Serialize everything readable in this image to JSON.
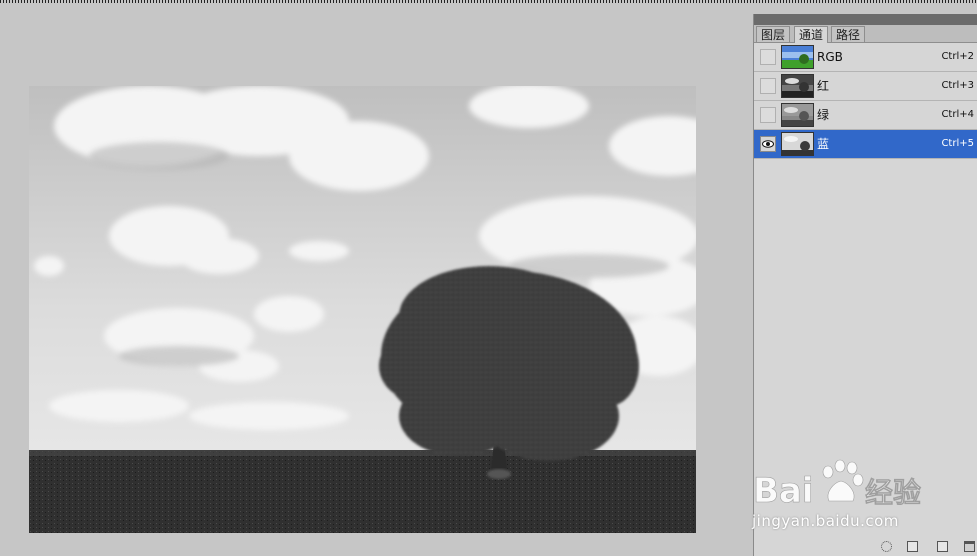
{
  "panel": {
    "tabs": [
      {
        "label": "图层"
      },
      {
        "label": "通道"
      },
      {
        "label": "路径"
      }
    ],
    "active_tab": "通道",
    "channels": [
      {
        "name": "RGB",
        "shortcut": "Ctrl+2",
        "visible": false,
        "selected": false
      },
      {
        "name": "红",
        "shortcut": "Ctrl+3",
        "visible": false,
        "selected": false
      },
      {
        "name": "绿",
        "shortcut": "Ctrl+4",
        "visible": false,
        "selected": false
      },
      {
        "name": "蓝",
        "shortcut": "Ctrl+5",
        "visible": true,
        "selected": true
      }
    ]
  },
  "watermark": {
    "url": "jingyan.baidu.com"
  },
  "colors": {
    "selection": "#3168c9",
    "workspace": "#c6c6c6",
    "panel": "#d6d6d6"
  }
}
